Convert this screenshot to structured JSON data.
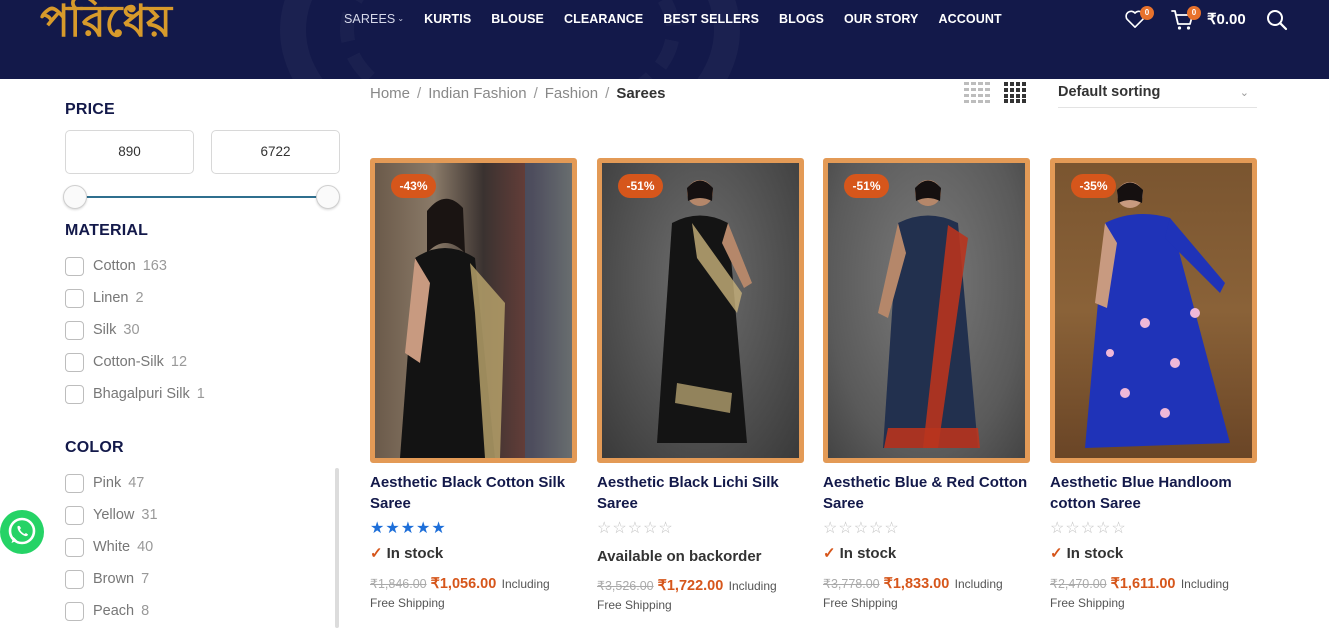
{
  "brand": {
    "logo_text": "পরিধেয়"
  },
  "nav": {
    "items": [
      {
        "label": "SAREES",
        "has_dropdown": true
      },
      {
        "label": "KURTIS"
      },
      {
        "label": "BLOUSE"
      },
      {
        "label": "CLEARANCE"
      },
      {
        "label": "BEST SELLERS"
      },
      {
        "label": "BLOGS"
      },
      {
        "label": "OUR STORY"
      },
      {
        "label": "ACCOUNT"
      }
    ]
  },
  "header_icons": {
    "wishlist_count": "0",
    "cart_count": "0",
    "cart_total": "₹0.00"
  },
  "sidebar": {
    "price": {
      "title": "PRICE",
      "min": "890",
      "max": "6722"
    },
    "material": {
      "title": "MATERIAL",
      "items": [
        {
          "label": "Cotton",
          "count": "163"
        },
        {
          "label": "Linen",
          "count": "2"
        },
        {
          "label": "Silk",
          "count": "30"
        },
        {
          "label": "Cotton-Silk",
          "count": "12"
        },
        {
          "label": "Bhagalpuri Silk",
          "count": "1"
        }
      ]
    },
    "color": {
      "title": "COLOR",
      "items": [
        {
          "label": "Pink",
          "count": "47"
        },
        {
          "label": "Yellow",
          "count": "31"
        },
        {
          "label": "White",
          "count": "40"
        },
        {
          "label": "Brown",
          "count": "7"
        },
        {
          "label": "Peach",
          "count": "8"
        }
      ]
    }
  },
  "breadcrumb": {
    "items": [
      "Home",
      "Indian Fashion",
      "Fashion"
    ],
    "current": "Sarees"
  },
  "sorting": {
    "selected": "Default sorting"
  },
  "products": [
    {
      "badge": "-43%",
      "title": "Aesthetic Black Cotton Silk Saree",
      "rating": "full",
      "stock": "In stock",
      "old_price": "₹1,846.00",
      "price": "₹1,056.00",
      "including": "Including",
      "shipping": "Free Shipping"
    },
    {
      "badge": "-51%",
      "title": "Aesthetic Black Lichi Silk Saree",
      "rating": "empty",
      "availability": "Available on backorder",
      "old_price": "₹3,526.00",
      "price": "₹1,722.00",
      "including": "Including",
      "shipping": "Free Shipping"
    },
    {
      "badge": "-51%",
      "title": "Aesthetic Blue & Red Cotton Saree",
      "rating": "empty",
      "stock": "In stock",
      "old_price": "₹3,778.00",
      "price": "₹1,833.00",
      "including": "Including",
      "shipping": "Free Shipping"
    },
    {
      "badge": "-35%",
      "title": "Aesthetic Blue Handloom cotton Saree",
      "rating": "empty",
      "stock": "In stock",
      "old_price": "₹2,470.00",
      "price": "₹1,611.00",
      "including": "Including",
      "shipping": "Free Shipping"
    }
  ],
  "colors": {
    "header_bg": "#13194a",
    "accent": "#d6561b",
    "image_border": "#e39a56",
    "rating_blue": "#1e6fd9",
    "whatsapp": "#25d366"
  },
  "icons": {
    "wishlist": "heart-icon",
    "cart": "cart-icon",
    "search": "search-icon",
    "grid_small": "grid-3-icon",
    "grid_large": "grid-4-icon",
    "whatsapp": "whatsapp-icon",
    "stock": "check-icon"
  }
}
